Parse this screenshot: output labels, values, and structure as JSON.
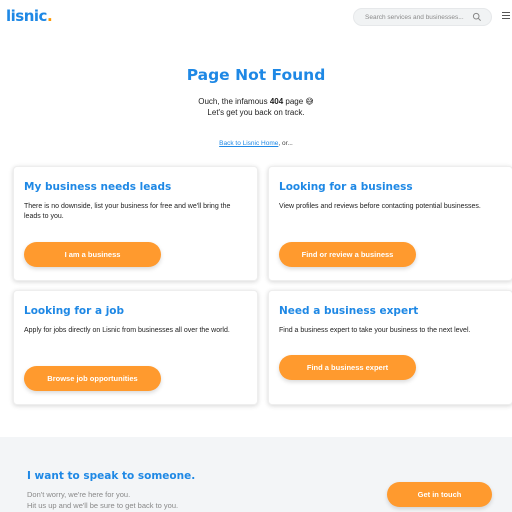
{
  "header": {
    "logo_text": "lisnic",
    "logo_dot": ".",
    "search_placeholder": "Search services and businesses..."
  },
  "hero": {
    "title": "Page Not Found",
    "line1_prefix": "Ouch, the infamous ",
    "line1_bold": "404",
    "line1_suffix": " page 😅",
    "line2": "Let's get you back on track.",
    "back_link": "Back to Lisnic Home",
    "back_suffix": ", or..."
  },
  "cards": [
    {
      "title": "My business needs leads",
      "text": "There is no downside, list your business for free and we'll bring the leads to you.",
      "button": "I am a business"
    },
    {
      "title": "Looking for a business",
      "text": "View profiles and reviews before contacting potential businesses.",
      "button": "Find or review a business"
    },
    {
      "title": "Looking for a job",
      "text": "Apply for jobs directly on Lisnic from businesses all over the world.",
      "button": "Browse job opportunities"
    },
    {
      "title": "Need a business expert",
      "text": "Find a business expert to take your business to the next level.",
      "button": "Find a business expert"
    }
  ],
  "contact": {
    "title": "I want to speak to someone.",
    "line1": "Don't worry, we're here for you.",
    "line2": "Hit us up and we'll be sure to get back to you.",
    "button": "Get in touch"
  },
  "colors": {
    "brand_blue": "#1e88e5",
    "accent_orange": "#ff9a2e"
  }
}
